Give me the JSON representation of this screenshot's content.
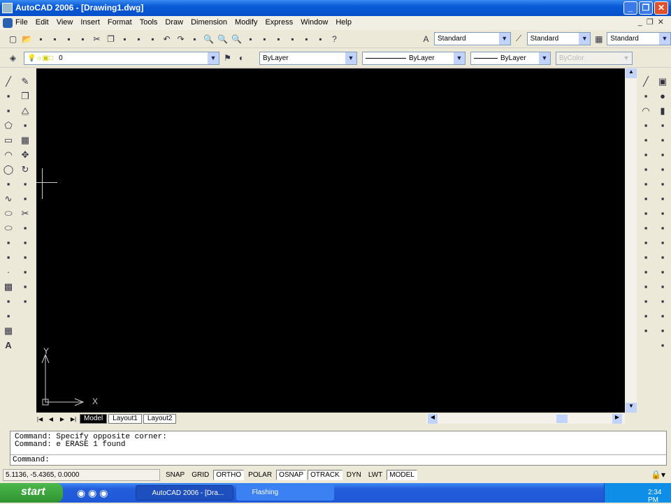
{
  "window": {
    "title": "AutoCAD 2006 - [Drawing1.dwg]",
    "min": "_",
    "restore": "❐",
    "close": "✕"
  },
  "menu": [
    "File",
    "Edit",
    "View",
    "Insert",
    "Format",
    "Tools",
    "Draw",
    "Dimension",
    "Modify",
    "Express",
    "Window",
    "Help"
  ],
  "toolbar1": {
    "icons": [
      "new-icon",
      "open-icon",
      "save-icon",
      "plot-icon",
      "plot-preview-icon",
      "publish-icon",
      "cut-icon",
      "copy-icon",
      "paste-icon",
      "match-properties-icon",
      "block-editor-icon",
      "undo-icon",
      "redo-icon",
      "pan-icon",
      "zoom-realtime-icon",
      "zoom-window-icon",
      "zoom-previous-icon",
      "properties-icon",
      "design-center-icon",
      "tool-palettes-icon",
      "sheet-set-icon",
      "markup-icon",
      "calculator-icon",
      "help-icon"
    ],
    "text_style": "Standard",
    "dim_style": "Standard",
    "table_style": "Standard"
  },
  "toolbar2": {
    "layer": "0",
    "color": "ByLayer",
    "linetype": "ByLayer",
    "lineweight": "ByLayer",
    "plotstyle": "ByColor"
  },
  "draw_tools": [
    "line-icon",
    "construction-line-icon",
    "polyline-icon",
    "polygon-icon",
    "rectangle-icon",
    "arc-icon",
    "circle-icon",
    "revision-cloud-icon",
    "spline-icon",
    "ellipse-icon",
    "ellipse-arc-icon",
    "insert-block-icon",
    "make-block-icon",
    "point-icon",
    "hatch-icon",
    "gradient-icon",
    "region-icon",
    "table-icon",
    "multiline-text-icon"
  ],
  "modify_tools": [
    "erase-icon",
    "copy-object-icon",
    "mirror-icon",
    "offset-icon",
    "array-icon",
    "move-icon",
    "rotate-icon",
    "scale-icon",
    "stretch-icon",
    "trim-icon",
    "extend-icon",
    "break-icon",
    "join-icon",
    "chamfer-icon",
    "fillet-icon",
    "explode-icon"
  ],
  "dim_tools": [
    "linear-dim-icon",
    "aligned-dim-icon",
    "arc-length-icon",
    "ordinate-icon",
    "radius-icon",
    "jogged-icon",
    "diameter-icon",
    "angular-icon",
    "quick-dim-icon",
    "baseline-icon",
    "continue-icon",
    "quick-leader-icon",
    "tolerance-icon",
    "center-mark-icon",
    "dimedit-icon",
    "dimtedit-icon",
    "dim-update-icon",
    "dim-style-icon"
  ],
  "shade_tools": [
    "box-icon",
    "sphere-icon",
    "cylinder-icon",
    "cone-icon",
    "wedge-icon",
    "torus-icon",
    "extrude-icon",
    "revolve-icon",
    "slice-icon",
    "section-icon",
    "interfere-icon",
    "setup-drawing-icon",
    "setup-view-icon",
    "setup-profile-icon",
    "2d-wireframe-icon",
    "3d-wireframe-icon",
    "hidden-icon",
    "flat-shaded-icon",
    "gouraud-icon"
  ],
  "ucs": {
    "x": "X",
    "y": "Y"
  },
  "tabs": {
    "model": "Model",
    "layout1": "Layout1",
    "layout2": "Layout2"
  },
  "command": {
    "lines": [
      "Command: Specify opposite corner:",
      "Command: e ERASE 1 found"
    ],
    "prompt": "Command:"
  },
  "status": {
    "coords": "5.1136, -5.4365, 0.0000",
    "buttons": [
      {
        "label": "SNAP",
        "on": false
      },
      {
        "label": "GRID",
        "on": false
      },
      {
        "label": "ORTHO",
        "on": true
      },
      {
        "label": "POLAR",
        "on": false
      },
      {
        "label": "OSNAP",
        "on": true
      },
      {
        "label": "OTRACK",
        "on": true
      },
      {
        "label": "DYN",
        "on": false
      },
      {
        "label": "LWT",
        "on": false
      },
      {
        "label": "MODEL",
        "on": true
      }
    ]
  },
  "taskbar": {
    "start": "start",
    "tasks": [
      "AutoCAD 2006 - [Dra...",
      "Flashing"
    ],
    "clock": "2:34 PM"
  },
  "colors": {
    "canvas": "#000000",
    "titlebar": "#0a5ad8",
    "taskbar": "#245edb",
    "start": "#2f932f"
  }
}
